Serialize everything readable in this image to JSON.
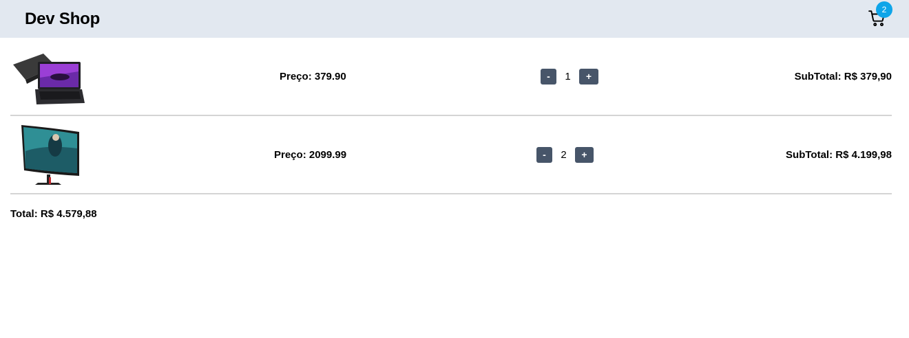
{
  "header": {
    "title": "Dev Shop",
    "cart_count": "2"
  },
  "cart": {
    "items": [
      {
        "image": "laptop-image",
        "price": "Preço: 379.90",
        "minus_label": "-",
        "quantity": "1",
        "plus_label": "+",
        "subtotal": "SubTotal: R$ 379,90"
      },
      {
        "image": "monitor-image",
        "price": "Preço: 2099.99",
        "minus_label": "-",
        "quantity": "2",
        "plus_label": "+",
        "subtotal": "SubTotal: R$ 4.199,98"
      }
    ],
    "total": "Total: R$ 4.579,88"
  },
  "colors": {
    "header_bg": "#e2e8f0",
    "badge": "#0ea5e9",
    "button": "#475569",
    "divider": "#d4d4d4"
  }
}
